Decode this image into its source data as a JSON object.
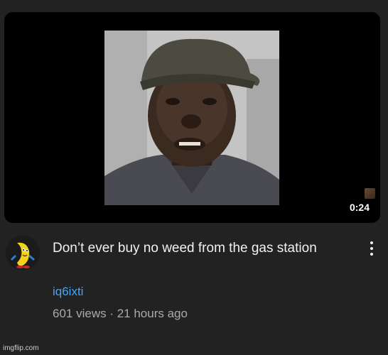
{
  "video": {
    "duration": "0:24",
    "title": "Don’t ever buy no weed from the gas station",
    "channel": "iq6ixti",
    "meta": "601 views · 21 hours ago"
  },
  "icons": {
    "menu": "more-vert-icon",
    "avatar": "banana-character-avatar"
  },
  "watermark": "imgflip.com",
  "colors": {
    "background": "#222222",
    "title": "#f1f1f1",
    "channel": "#3ea6ff",
    "meta": "#aaaaaa"
  }
}
